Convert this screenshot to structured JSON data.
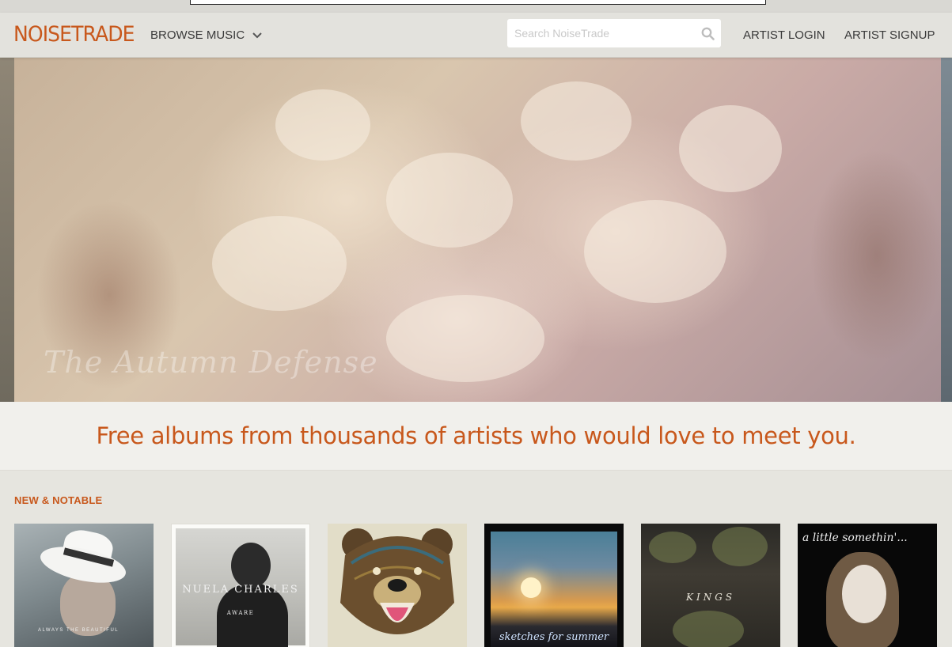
{
  "header": {
    "logo": "NOISETRADE",
    "browse_label": "BROWSE MUSIC",
    "search_placeholder": "Search NoiseTrade",
    "login_label": "ARTIST LOGIN",
    "signup_label": "ARTIST SIGNUP"
  },
  "hero": {
    "caption": "The Autumn Defense"
  },
  "tagline": "Free albums from thousands of artists who would love to meet you.",
  "new_notable": {
    "title": "NEW & NOTABLE",
    "albums": [
      {
        "cover_text": "ALWAYS THE BEAUTIFUL"
      },
      {
        "cover_title": "NUELA CHARLES",
        "cover_sub": "AWARE"
      },
      {
        "cover_text": ""
      },
      {
        "cover_title": "sketches for summer"
      },
      {
        "cover_title": "KINGS"
      },
      {
        "cover_title": "a little somethin'..."
      }
    ]
  },
  "colors": {
    "accent": "#c8581c",
    "header_bg": "#e3e2dd",
    "page_bg": "#e6e5df"
  }
}
